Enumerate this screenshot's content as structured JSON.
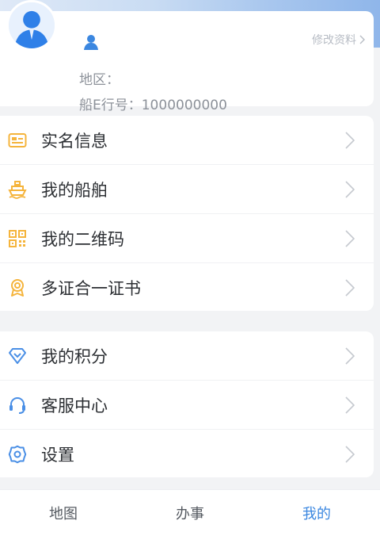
{
  "profile": {
    "edit_label": "修改资料",
    "region_label": "地区：",
    "ship_id_label": "船E行号：",
    "ship_id_value": "1000000000",
    "ship_id_text": "船E行号：1000000000"
  },
  "menu_group_1": [
    {
      "label": "实名信息",
      "icon": "id-card-icon"
    },
    {
      "label": "我的船舶",
      "icon": "ship-icon"
    },
    {
      "label": "我的二维码",
      "icon": "qr-code-icon"
    },
    {
      "label": "多证合一证书",
      "icon": "certificate-badge-icon"
    }
  ],
  "menu_group_2": [
    {
      "label": "我的积分",
      "icon": "diamond-icon"
    },
    {
      "label": "客服中心",
      "icon": "headset-icon"
    },
    {
      "label": "设置",
      "icon": "gear-icon"
    }
  ],
  "tabbar": {
    "tabs": [
      {
        "label": "地图"
      },
      {
        "label": "办事"
      },
      {
        "label": "我的",
        "active": true
      }
    ]
  },
  "colors": {
    "accent": "#3b87e0",
    "orange_icon": "#f5b43c",
    "blue_icon": "#4a8fe6"
  }
}
